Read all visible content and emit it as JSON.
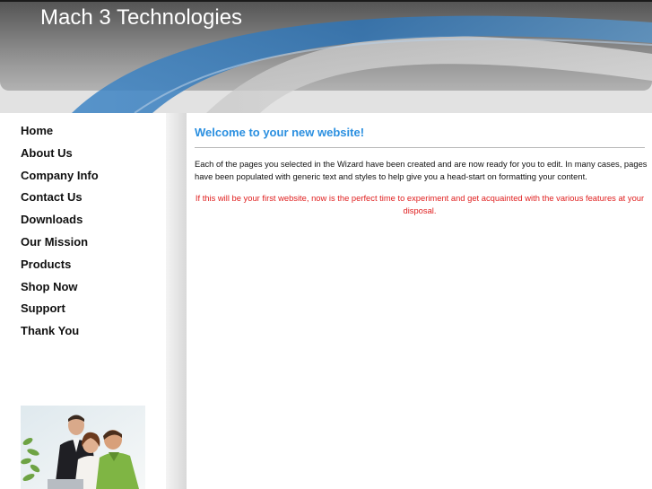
{
  "header": {
    "site_title": "Mach 3 Technologies"
  },
  "sidebar": {
    "nav_items": [
      {
        "label": "Home"
      },
      {
        "label": "About Us"
      },
      {
        "label": "Company Info"
      },
      {
        "label": "Contact Us"
      },
      {
        "label": "Downloads"
      },
      {
        "label": "Our Mission"
      },
      {
        "label": "Products"
      },
      {
        "label": "Shop Now"
      },
      {
        "label": "Support"
      },
      {
        "label": "Thank You"
      }
    ],
    "photo_icon": "business-team-photo"
  },
  "content": {
    "heading": "Welcome to your new website!",
    "intro": "Each of the pages you selected in the Wizard have been created and are now ready for you to edit. In many cases, pages have been populated with generic text and styles to help give you a head-start on formatting your content.",
    "first_website_note": "If this will be your first website, now is the perfect time to experiment and get acquainted with the various features at your disposal."
  },
  "colors": {
    "heading_blue": "#2a8fe0",
    "note_red": "#e02020",
    "swoosh_blue": "#2f73b3"
  }
}
